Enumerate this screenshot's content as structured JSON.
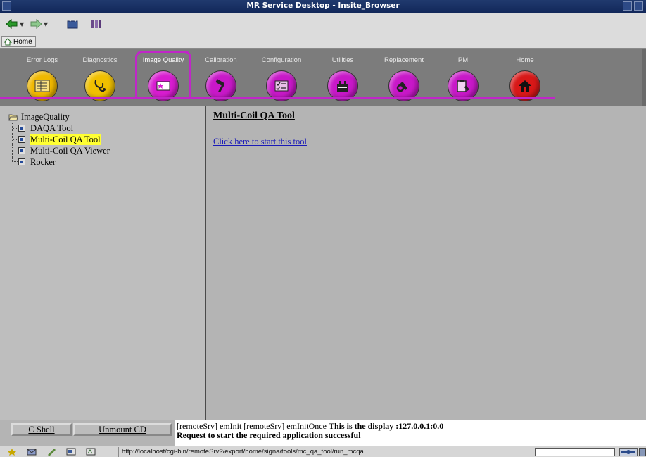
{
  "window": {
    "title": "MR Service Desktop - Insite_Browser"
  },
  "navbar": {
    "icons": [
      "back-arrow-icon",
      "forward-arrow-icon",
      "reload-icon",
      "bookmarks-icon"
    ]
  },
  "homebar": {
    "home_label": "Home"
  },
  "tabs": [
    {
      "label": "Error Logs",
      "icon": "error-log-icon",
      "color": "#f0b800",
      "active": false
    },
    {
      "label": "Diagnostics",
      "icon": "stethoscope-icon",
      "color": "#f0c000",
      "active": false
    },
    {
      "label": "Image Quality",
      "icon": "image-quality-icon",
      "color": "#d81cd0",
      "active": true
    },
    {
      "label": "Calibration",
      "icon": "hammer-icon",
      "color": "#c818c8",
      "active": false
    },
    {
      "label": "Configuration",
      "icon": "checklist-icon",
      "color": "#c818c8",
      "active": false
    },
    {
      "label": "Utilities",
      "icon": "toolbox-icon",
      "color": "#c818c8",
      "active": false
    },
    {
      "label": "Replacement",
      "icon": "wrench-icon",
      "color": "#c818c8",
      "active": false
    },
    {
      "label": "PM",
      "icon": "clipboard-icon",
      "color": "#c818c8",
      "active": false
    },
    {
      "label": "Home",
      "icon": "home-icon",
      "color": "#d81818",
      "active": false
    }
  ],
  "tree": {
    "root": "ImageQuality",
    "items": [
      {
        "label": "DAQA Tool",
        "selected": false
      },
      {
        "label": "Multi-Coil QA Tool",
        "selected": true
      },
      {
        "label": "Multi-Coil QA Viewer",
        "selected": false
      },
      {
        "label": "Rocker",
        "selected": false
      }
    ]
  },
  "content": {
    "title": "Multi-Coil QA Tool",
    "link": "Click here to start this tool"
  },
  "bottom": {
    "cshell_label": "C Shell",
    "unmount_label": "Unmount CD",
    "console_line1_plain": "[remoteSrv] emInit [remoteSrv] emInitOnce ",
    "console_line1_bold": "This is the display :127.0.0.1:0.0",
    "console_line2_bold": "Request to start the required application successful"
  },
  "statusbar": {
    "url": "http://localhost/cgi-bin/remoteSrv?/export/home/signa/tools/mc_qa_tool/run_mcqa"
  },
  "colors": {
    "accent": "#c026c8",
    "titlebar": "#1a3066",
    "selection": "#ffff33",
    "link": "#1a1ab8"
  }
}
